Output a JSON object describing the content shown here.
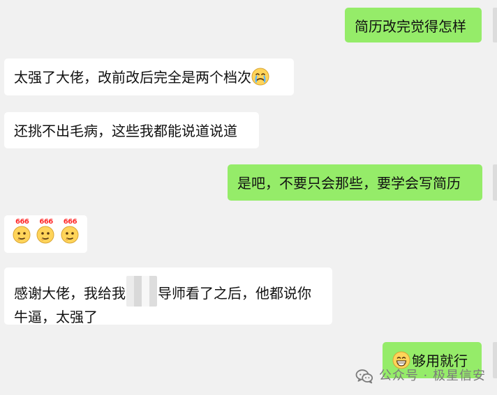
{
  "messages": [
    {
      "direction": "out",
      "text": "简历改完觉得怎样"
    },
    {
      "direction": "in",
      "text": "太强了大佬，改前改后完全是两个档次"
    },
    {
      "direction": "in",
      "text": "还挑不出毛病，这些我都能说道说道"
    },
    {
      "direction": "out",
      "text": "是吧，不要只会那些，要学会写简历"
    },
    {
      "direction": "in",
      "emoji_badge": "666"
    },
    {
      "direction": "in",
      "text_before_redaction": "感谢大佬，我给我",
      "text_after_redaction": "导师看了之后，他都说你牛逼，太强了"
    },
    {
      "direction": "out",
      "text": "够用就行"
    }
  ],
  "watermark": {
    "icon": "wechat-icon",
    "text": "公众号 · 极星信安"
  },
  "colors": {
    "background": "#f1f1f1",
    "incoming_bubble": "#ffffff",
    "outgoing_bubble": "#95ec69",
    "text": "#111111",
    "badge_red": "#ff2a2a",
    "emoji_yellow": "#ffd45a"
  },
  "icons": {
    "crying_face": "crying-face-icon",
    "thinking_face": "thinking-face-icon",
    "grinning_face": "grinning-face-icon"
  }
}
